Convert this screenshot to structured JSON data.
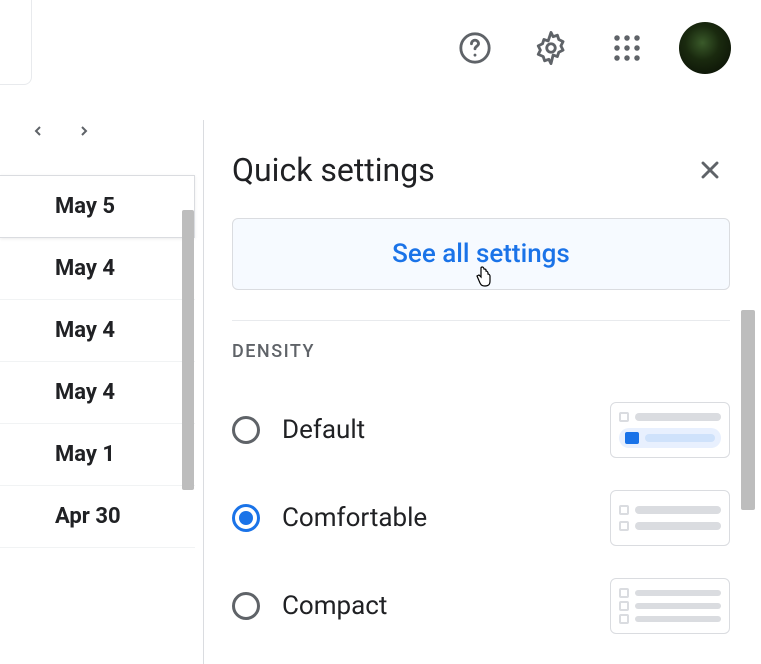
{
  "panel": {
    "title": "Quick settings",
    "see_all_label": "See all settings",
    "density_section": "DENSITY",
    "options": {
      "default": "Default",
      "comfortable": "Comfortable",
      "compact": "Compact"
    },
    "selected": "comfortable"
  },
  "dates": [
    "May 5",
    "May 4",
    "May 4",
    "May 4",
    "May 1",
    "Apr 30"
  ]
}
